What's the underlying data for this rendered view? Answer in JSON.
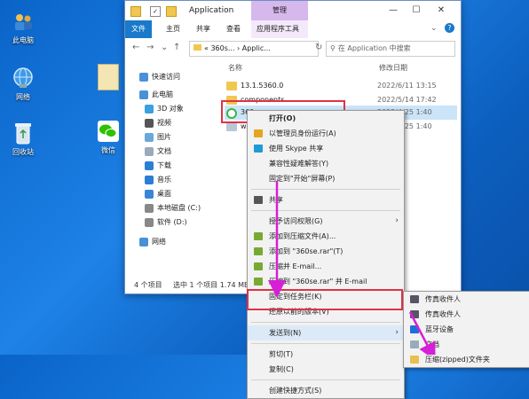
{
  "desktop": {
    "icons": [
      {
        "label": "此电脑",
        "icon": "computer-icon"
      },
      {
        "label": "网络",
        "icon": "network-icon"
      },
      {
        "label": "回收站",
        "icon": "recycle-bin-icon"
      },
      {
        "label": "微信",
        "icon": "wechat-icon"
      }
    ]
  },
  "window": {
    "title": "Application",
    "ctx_tab_header": "管理",
    "ribbon_tabs": [
      "文件",
      "主页",
      "共享",
      "查看",
      "应用程序工具"
    ],
    "address": "«  360s...  ›  Applic...",
    "search_placeholder": "在 Application 中搜索",
    "col_name": "名称",
    "col_date": "修改日期",
    "nav": [
      {
        "label": "快速访问",
        "icon": "star-icon",
        "color": "#4a90d9"
      },
      {
        "label": "此电脑",
        "icon": "computer-icon",
        "color": "#4a90d9"
      },
      {
        "label": "3D 对象",
        "icon": "cube-icon",
        "color": "#3aa0e0",
        "sub": true
      },
      {
        "label": "视频",
        "icon": "video-icon",
        "color": "#555",
        "sub": true
      },
      {
        "label": "图片",
        "icon": "picture-icon",
        "color": "#6aa8d8",
        "sub": true
      },
      {
        "label": "文档",
        "icon": "document-icon",
        "color": "#9ab",
        "sub": true
      },
      {
        "label": "下载",
        "icon": "download-icon",
        "color": "#2a7fd4",
        "sub": true
      },
      {
        "label": "音乐",
        "icon": "music-icon",
        "color": "#2a7fd4",
        "sub": true
      },
      {
        "label": "桌面",
        "icon": "desktop-icon",
        "color": "#3a86d6",
        "sub": true
      },
      {
        "label": "本地磁盘 (C:)",
        "icon": "drive-icon",
        "color": "#888",
        "sub": true
      },
      {
        "label": "软件 (D:)",
        "icon": "drive-icon",
        "color": "#888",
        "sub": true
      },
      {
        "label": "网络",
        "icon": "network-icon",
        "color": "#4a90d9"
      }
    ],
    "files": [
      {
        "name": "13.1.5360.0",
        "date": "2022/6/11 13:15"
      },
      {
        "name": "components",
        "date": "2022/5/14 17:42"
      },
      {
        "name": "360se.exe",
        "date": "2022/4/25 1:40"
      },
      {
        "name": "wow_helper",
        "date": "2022/4/25 1:40"
      }
    ],
    "status_items": "4 个项目",
    "status_selected": "选中 1 个项目  1.74 MB"
  },
  "context_menu": {
    "items": [
      {
        "label": "打开(O)",
        "bold": true
      },
      {
        "label": "以管理员身份运行(A)",
        "icon": "shield-icon",
        "color": "#e6a520"
      },
      {
        "label": "使用 Skype 共享",
        "icon": "skype-icon",
        "color": "#1e9ad8"
      },
      {
        "label": "兼容性疑难解答(Y)"
      },
      {
        "label": "固定到\"开始\"屏幕(P)"
      },
      {
        "sep": true
      },
      {
        "label": "共享",
        "icon": "share-icon",
        "color": "#555"
      },
      {
        "sep": true
      },
      {
        "label": "授予访问权限(G)",
        "arrow": true
      },
      {
        "label": "添加到压缩文件(A)...",
        "icon": "archive-icon",
        "color": "#7a3"
      },
      {
        "label": "添加到 \"360se.rar\"(T)",
        "icon": "archive-icon",
        "color": "#7a3"
      },
      {
        "label": "压缩并 E-mail...",
        "icon": "archive-icon",
        "color": "#7a3"
      },
      {
        "label": "压缩到 \"360se.rar\" 并 E-mail",
        "icon": "archive-icon",
        "color": "#7a3"
      },
      {
        "label": "固定到任务栏(K)"
      },
      {
        "label": "还原以前的版本(V)"
      },
      {
        "sep": true
      },
      {
        "label": "发送到(N)",
        "arrow": true,
        "highlight": true
      },
      {
        "sep": true
      },
      {
        "label": "剪切(T)"
      },
      {
        "label": "复制(C)"
      },
      {
        "sep": true
      },
      {
        "label": "创建快捷方式(S)"
      }
    ]
  },
  "submenu": {
    "items": [
      {
        "label": "传真收件人",
        "icon": "fax-icon",
        "color": "#556"
      },
      {
        "label": "传真收件人",
        "icon": "fax-icon",
        "color": "#556"
      },
      {
        "label": "蓝牙设备",
        "icon": "bluetooth-icon",
        "color": "#1e6fd8"
      },
      {
        "label": "文档",
        "icon": "document-icon",
        "color": "#9ab"
      },
      {
        "label": "压缩(zipped)文件夹",
        "icon": "zip-folder-icon",
        "color": "#e8c050"
      }
    ]
  },
  "colors": {
    "accent": "#1979ca",
    "highlight_box": "#e03246",
    "arrow": "#d61fd6"
  }
}
